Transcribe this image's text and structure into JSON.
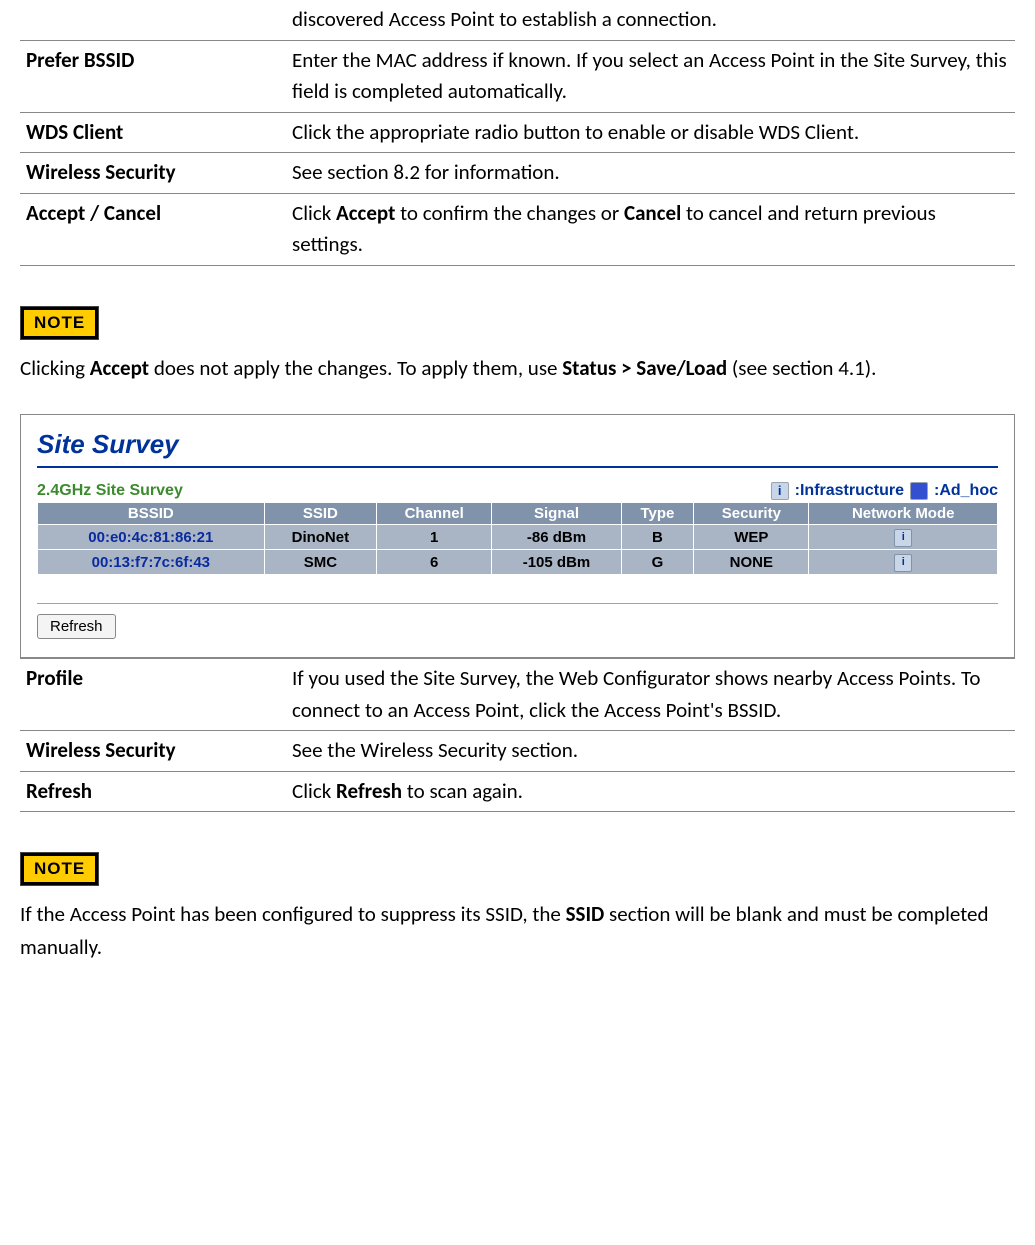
{
  "table1": {
    "row0": {
      "desc": "discovered Access Point to establish a connection."
    },
    "row1": {
      "term": "Prefer BSSID",
      "desc": "Enter the MAC address if known. If you select an Access Point in the Site Survey, this field is completed automatically."
    },
    "row2": {
      "term": "WDS Client",
      "desc": "Click the appropriate radio button to enable or disable WDS Client."
    },
    "row3": {
      "term": "Wireless Security",
      "desc": "See section 8.2 for information."
    },
    "row4": {
      "term": "Accept / Cancel",
      "pre": "Click ",
      "b1": "Accept",
      "mid": " to confirm the changes or ",
      "b2": "Cancel",
      "post": " to cancel and return previous settings."
    }
  },
  "note1": {
    "label": "NOTE",
    "pre": "Clicking ",
    "b1": "Accept",
    "mid": " does not apply the changes. To apply them, use ",
    "b2": "Status > Save/Load",
    "post": " (see section 4.1)."
  },
  "survey": {
    "title": "Site Survey",
    "band": "2.4GHz Site Survey",
    "legend_infra": ":Infrastructure ",
    "legend_adhoc": ":Ad_hoc",
    "refresh_label": "Refresh",
    "headers": {
      "bssid": "BSSID",
      "ssid": "SSID",
      "channel": "Channel",
      "signal": "Signal",
      "type": "Type",
      "security": "Security",
      "mode": "Network Mode"
    },
    "rows": [
      {
        "bssid": "00:e0:4c:81:86:21",
        "ssid": "DinoNet",
        "channel": "1",
        "signal": "-86 dBm",
        "type": "B",
        "security": "WEP"
      },
      {
        "bssid": "00:13:f7:7c:6f:43",
        "ssid": "SMC",
        "channel": "6",
        "signal": "-105 dBm",
        "type": "G",
        "security": "NONE"
      }
    ]
  },
  "table2": {
    "row1": {
      "term": "Profile",
      "desc": "If you used the Site Survey, the Web Configurator shows nearby Access Points. To connect to an Access Point, click the Access Point's BSSID."
    },
    "row2": {
      "term": "Wireless Security",
      "desc": "See the Wireless Security section."
    },
    "row3": {
      "term": "Refresh",
      "pre": "Click ",
      "b1": "Refresh",
      "post": " to scan again."
    }
  },
  "note2": {
    "label": "NOTE",
    "pre": "If the Access Point has been configured to suppress its SSID, the ",
    "b1": "SSID",
    "post": " section will be blank and must be completed manually."
  }
}
